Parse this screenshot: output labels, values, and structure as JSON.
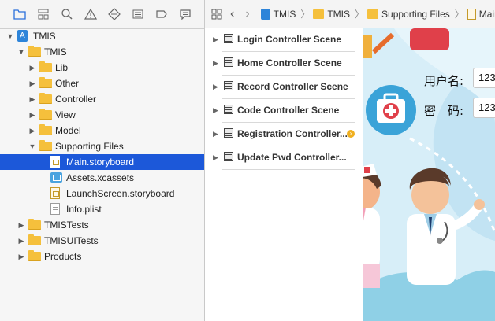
{
  "navigator": {
    "toolbar_icons": [
      "folder-icon",
      "hierarchy-icon",
      "search-icon",
      "warning-icon",
      "test-icon",
      "debug-icon",
      "breakpoint-icon",
      "report-icon"
    ],
    "tree": [
      {
        "label": "TMIS",
        "kind": "project",
        "depth": 0,
        "disclosure": "open"
      },
      {
        "label": "TMIS",
        "kind": "folder",
        "depth": 1,
        "disclosure": "open"
      },
      {
        "label": "Lib",
        "kind": "folder",
        "depth": 2,
        "disclosure": "closed"
      },
      {
        "label": "Other",
        "kind": "folder",
        "depth": 2,
        "disclosure": "closed"
      },
      {
        "label": "Controller",
        "kind": "folder",
        "depth": 2,
        "disclosure": "closed"
      },
      {
        "label": "View",
        "kind": "folder",
        "depth": 2,
        "disclosure": "closed"
      },
      {
        "label": "Model",
        "kind": "folder",
        "depth": 2,
        "disclosure": "closed"
      },
      {
        "label": "Supporting Files",
        "kind": "folder",
        "depth": 2,
        "disclosure": "open"
      },
      {
        "label": "Main.storyboard",
        "kind": "storyboard",
        "depth": 3,
        "selected": true
      },
      {
        "label": "Assets.xcassets",
        "kind": "assets",
        "depth": 3
      },
      {
        "label": "LaunchScreen.storyboard",
        "kind": "storyboard",
        "depth": 3
      },
      {
        "label": "Info.plist",
        "kind": "plist",
        "depth": 3
      },
      {
        "label": "TMISTests",
        "kind": "folder",
        "depth": 1,
        "disclosure": "closed"
      },
      {
        "label": "TMISUITests",
        "kind": "folder",
        "depth": 1,
        "disclosure": "closed"
      },
      {
        "label": "Products",
        "kind": "folder",
        "depth": 1,
        "disclosure": "closed"
      }
    ]
  },
  "jumpbar": {
    "crumbs": [
      {
        "label": "TMIS",
        "icon": "project-icon"
      },
      {
        "label": "TMIS",
        "icon": "folder-icon"
      },
      {
        "label": "Supporting Files",
        "icon": "folder-icon"
      },
      {
        "label": "Main.s",
        "icon": "storyboard-icon"
      }
    ]
  },
  "outline": {
    "scenes": [
      {
        "label": "Login Controller Scene",
        "warning": false
      },
      {
        "label": "Home Controller Scene",
        "warning": false
      },
      {
        "label": "Record Controller Scene",
        "warning": false
      },
      {
        "label": "Code Controller Scene",
        "warning": false
      },
      {
        "label": "Registration Controller...",
        "warning": true
      },
      {
        "label": "Update Pwd Controller...",
        "warning": false
      }
    ]
  },
  "canvas": {
    "username_label": "用户名:",
    "username_value": "123",
    "password_label": "密　码:",
    "password_value": "123"
  }
}
